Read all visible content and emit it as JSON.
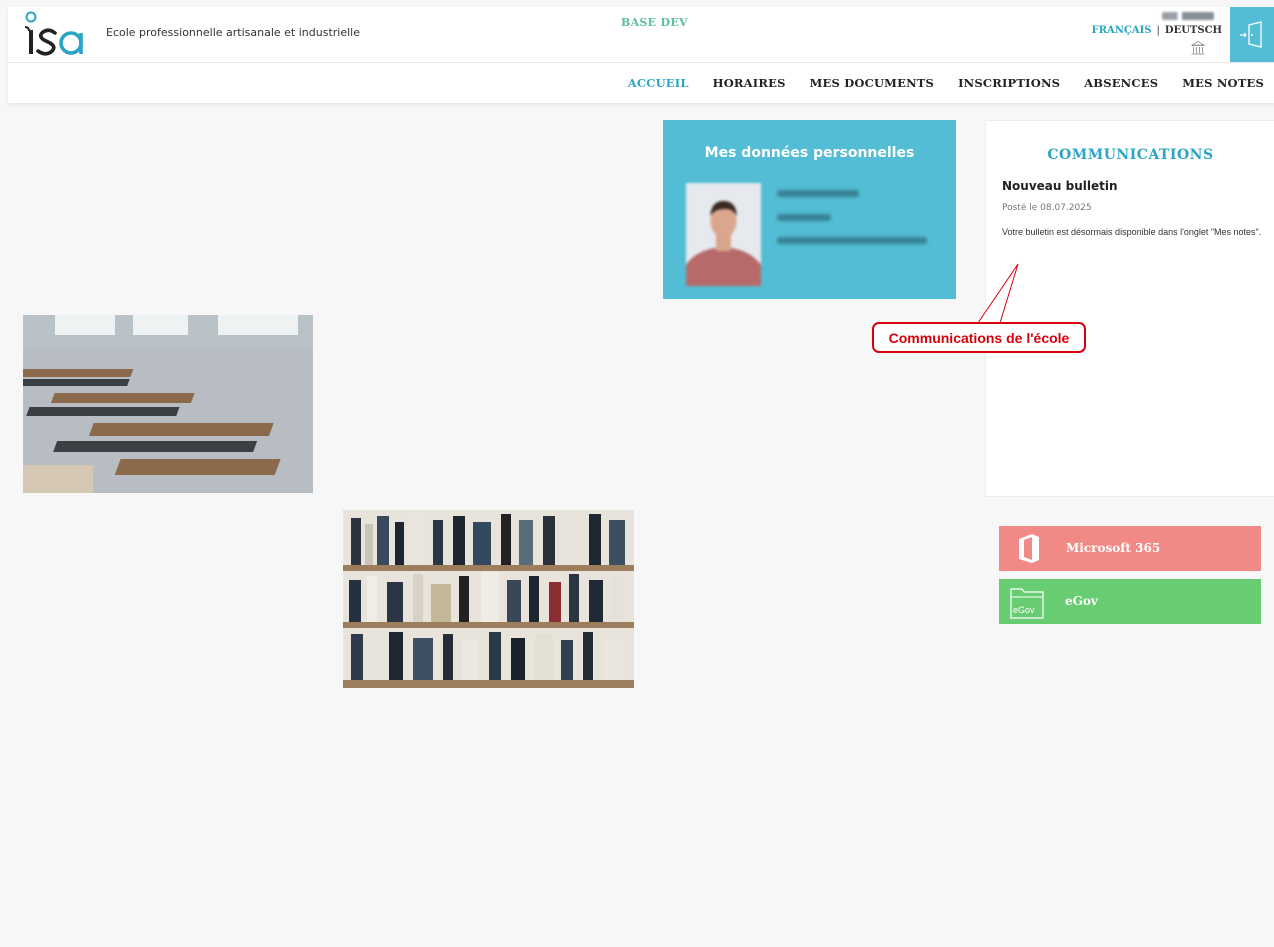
{
  "header": {
    "logo_text": "isa",
    "school_name": "Ecole professionnelle artisanale et industrielle",
    "environment": "BASE DEV",
    "languages": {
      "fr": "FRANÇAIS",
      "separator": "|",
      "de": "DEUTSCH"
    }
  },
  "nav": {
    "items": [
      {
        "label": "ACCUEIL",
        "active": true
      },
      {
        "label": "HORAIRES"
      },
      {
        "label": "MES DOCUMENTS"
      },
      {
        "label": "INSCRIPTIONS"
      },
      {
        "label": "ABSENCES"
      },
      {
        "label": "MES NOTES"
      }
    ]
  },
  "personal": {
    "title": "Mes données personnelles"
  },
  "communications": {
    "title": "COMMUNICATIONS",
    "items": [
      {
        "title": "Nouveau bulletin",
        "date": "Posté le 08.07.2025",
        "body": "Votre bulletin est désormais disponible dans l'onglet \"Mes notes\"."
      }
    ]
  },
  "callout": {
    "text": "Communications de l'école"
  },
  "external_links": {
    "microsoft": {
      "label": "Microsoft 365",
      "icon": "office-icon"
    },
    "egov": {
      "label": "eGov",
      "icon_text": "eGov",
      "icon": "folder-icon"
    }
  },
  "colors": {
    "accent": "#2aa6c4",
    "panel_blue": "#52bdd4",
    "microsoft": "#f18a87",
    "egov": "#68cc72",
    "callout": "#d8000c",
    "env_label": "#5bbfa0"
  }
}
